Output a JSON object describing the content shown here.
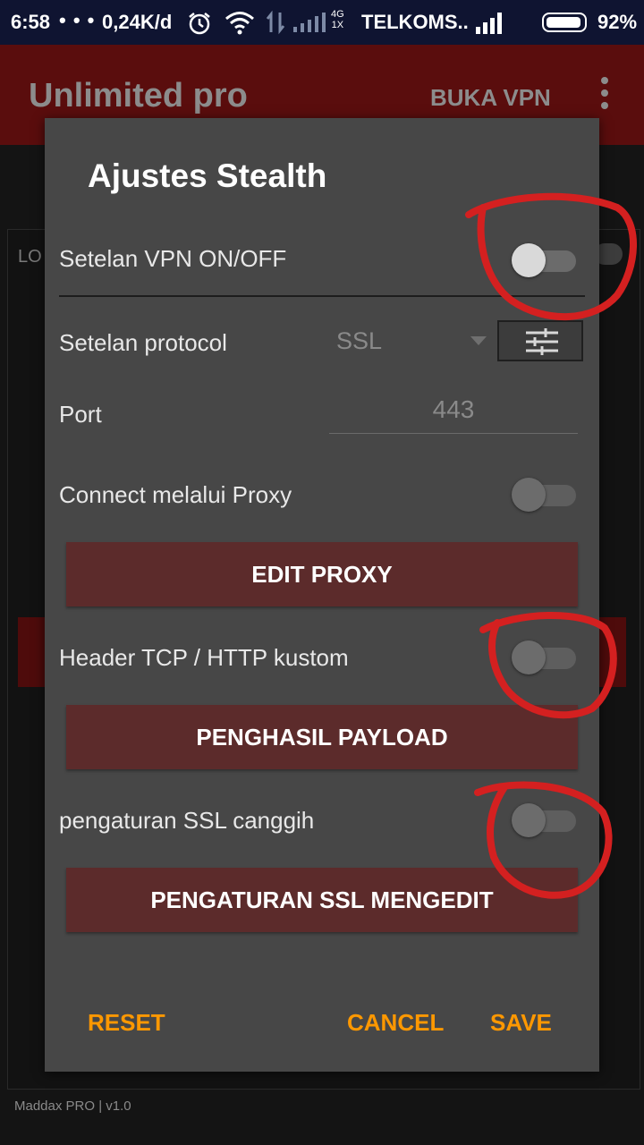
{
  "status_bar": {
    "time": "6:58",
    "notifications": "• • •",
    "speed": "0,24K/d",
    "network_type_top": "4G",
    "network_type_bottom": "1X",
    "carrier": "TELKOMS..",
    "battery": "92%"
  },
  "app_bar": {
    "title": "Unlimited pro",
    "action": "BUKA VPN"
  },
  "background": {
    "log_label": "LO",
    "footer": "Maddax PRO | v1.0"
  },
  "dialog": {
    "title": "Ajustes Stealth",
    "vpn_toggle_label": "Setelan VPN ON/OFF",
    "vpn_toggle_on": false,
    "protocol_label": "Setelan protocol",
    "protocol_value": "SSL",
    "port_label": "Port",
    "port_value": "443",
    "proxy_label": "Connect melalui Proxy",
    "proxy_on": false,
    "edit_proxy": "EDIT PROXY",
    "header_label": "Header TCP / HTTP kustom",
    "header_on": false,
    "payload_button": "PENGHASIL PAYLOAD",
    "ssl_label": "pengaturan SSL canggih",
    "ssl_on": false,
    "ssl_button": "PENGATURAN SSL MENGEDIT",
    "reset": "RESET",
    "cancel": "CANCEL",
    "save": "SAVE"
  },
  "colors": {
    "accent": "#ff9800",
    "button_bg": "#5c2b2b",
    "annotation": "#d42020"
  }
}
